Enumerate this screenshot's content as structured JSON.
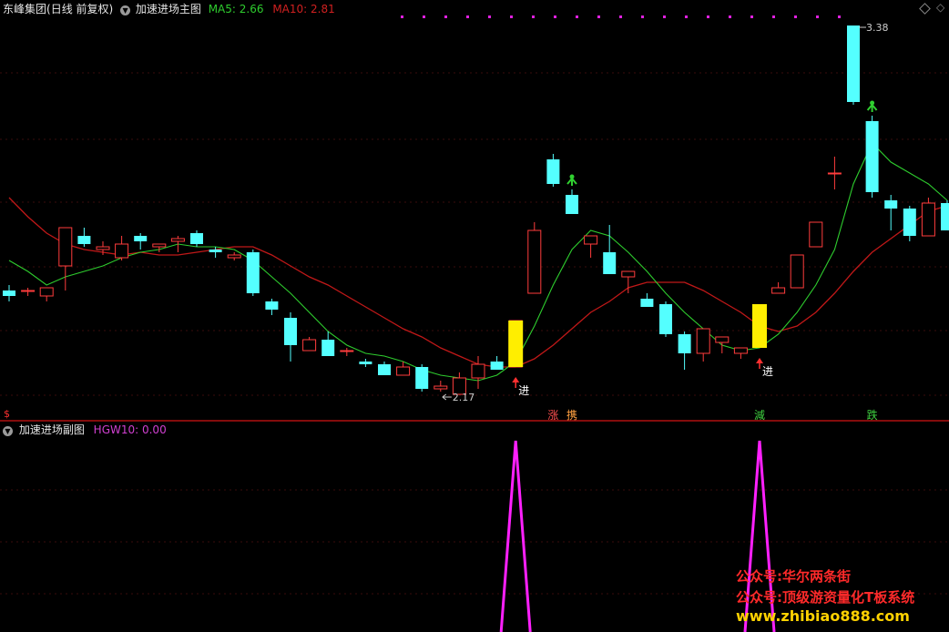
{
  "main_panel": {
    "stock_name": "东峰集团",
    "period": "(日线 前复权)",
    "indicator_name": "加速进场主图",
    "ma5_label": "MA5: 2.66",
    "ma10_label": "MA10: 2.81",
    "high_label": "3.38",
    "low_label": "2.17",
    "corner_mark": "$",
    "signal_labels": {
      "enter": "进",
      "up": "涨",
      "buy": "携",
      "reduce": "減",
      "fall": "跌"
    }
  },
  "sub_panel": {
    "indicator_name": "加速进场副图",
    "hgw_label": "HGW10: 0.00"
  },
  "watermark": {
    "line1": "公众号:华尔两条街",
    "line2": "公众号:顶级游资量化T板系统",
    "line3": "www.zhibiao888.com"
  },
  "colors": {
    "background": "#000000",
    "up_candle": "#ff3c3c",
    "down_candle": "#54ffff",
    "ma5": "#2ecc2e",
    "ma10": "#c01818",
    "signal_bar": "#ffee00",
    "hgw_line": "#ff20ff",
    "watermark_red": "#ff2a2a",
    "watermark_yellow": "#ffd200"
  },
  "chart_data": {
    "type": "candlestick",
    "title": "东峰集团(日线 前复权)",
    "ohlc": [
      [
        2.41,
        2.43,
        2.37,
        2.39
      ],
      [
        2.41,
        2.42,
        2.39,
        2.41
      ],
      [
        2.39,
        2.42,
        2.37,
        2.42
      ],
      [
        2.5,
        2.64,
        2.41,
        2.64
      ],
      [
        2.61,
        2.64,
        2.57,
        2.58
      ],
      [
        2.56,
        2.59,
        2.54,
        2.57
      ],
      [
        2.53,
        2.61,
        2.52,
        2.58
      ],
      [
        2.61,
        2.62,
        2.56,
        2.59
      ],
      [
        2.57,
        2.58,
        2.55,
        2.58
      ],
      [
        2.59,
        2.61,
        2.55,
        2.6
      ],
      [
        2.62,
        2.63,
        2.57,
        2.58
      ],
      [
        2.56,
        2.57,
        2.53,
        2.55
      ],
      [
        2.53,
        2.55,
        2.52,
        2.54
      ],
      [
        2.55,
        2.56,
        2.39,
        2.4
      ],
      [
        2.37,
        2.38,
        2.32,
        2.34
      ],
      [
        2.31,
        2.33,
        2.15,
        2.21
      ],
      [
        2.19,
        2.24,
        2.19,
        2.23
      ],
      [
        2.23,
        2.26,
        2.17,
        2.17
      ],
      [
        2.19,
        2.2,
        2.17,
        2.19
      ],
      [
        2.15,
        2.16,
        2.13,
        2.14
      ],
      [
        2.14,
        2.15,
        2.1,
        2.1
      ],
      [
        2.1,
        2.15,
        2.1,
        2.13
      ],
      [
        2.13,
        2.14,
        2.04,
        2.05
      ],
      [
        2.05,
        2.08,
        2.04,
        2.06
      ],
      [
        2.03,
        2.11,
        2.03,
        2.09
      ],
      [
        2.09,
        2.17,
        2.05,
        2.14
      ],
      [
        2.15,
        2.17,
        2.13,
        2.12
      ],
      [
        2.13,
        2.3,
        2.13,
        2.3
      ],
      [
        2.4,
        2.66,
        2.4,
        2.63
      ],
      [
        2.89,
        2.91,
        2.79,
        2.8
      ],
      [
        2.76,
        2.78,
        2.69,
        2.69
      ],
      [
        2.58,
        2.61,
        2.53,
        2.61
      ],
      [
        2.55,
        2.65,
        2.51,
        2.47
      ],
      [
        2.46,
        2.48,
        2.4,
        2.48
      ],
      [
        2.38,
        2.4,
        2.36,
        2.35
      ],
      [
        2.36,
        2.37,
        2.24,
        2.25
      ],
      [
        2.25,
        2.26,
        2.12,
        2.18
      ],
      [
        2.18,
        2.26,
        2.15,
        2.27
      ],
      [
        2.22,
        2.24,
        2.18,
        2.24
      ],
      [
        2.18,
        2.18,
        2.16,
        2.2
      ],
      [
        2.36,
        2.36,
        2.2,
        2.2
      ],
      [
        2.4,
        2.44,
        2.4,
        2.42
      ],
      [
        2.42,
        2.54,
        2.42,
        2.54
      ],
      [
        2.57,
        2.66,
        2.57,
        2.66
      ],
      [
        2.84,
        2.9,
        2.78,
        2.84
      ],
      [
        3.38,
        3.38,
        3.09,
        3.1
      ],
      [
        3.03,
        3.05,
        2.75,
        2.77
      ],
      [
        2.74,
        2.76,
        2.63,
        2.71
      ],
      [
        2.71,
        2.72,
        2.59,
        2.61
      ],
      [
        2.61,
        2.75,
        2.61,
        2.73
      ],
      [
        2.73,
        2.74,
        2.66,
        2.63
      ]
    ],
    "ma5": [
      2.52,
      2.48,
      2.43,
      2.46,
      2.48,
      2.5,
      2.53,
      2.55,
      2.56,
      2.58,
      2.57,
      2.57,
      2.56,
      2.52,
      2.46,
      2.4,
      2.33,
      2.26,
      2.21,
      2.18,
      2.17,
      2.15,
      2.12,
      2.1,
      2.09,
      2.08,
      2.1,
      2.15,
      2.28,
      2.43,
      2.56,
      2.63,
      2.61,
      2.55,
      2.48,
      2.4,
      2.33,
      2.27,
      2.21,
      2.19,
      2.2,
      2.25,
      2.33,
      2.43,
      2.56,
      2.8,
      2.95,
      2.88,
      2.84,
      2.8,
      2.74
    ],
    "ma10": [
      2.75,
      2.68,
      2.62,
      2.58,
      2.56,
      2.55,
      2.54,
      2.55,
      2.54,
      2.54,
      2.55,
      2.56,
      2.57,
      2.57,
      2.54,
      2.5,
      2.46,
      2.43,
      2.39,
      2.35,
      2.31,
      2.27,
      2.24,
      2.2,
      2.17,
      2.14,
      2.13,
      2.13,
      2.16,
      2.21,
      2.27,
      2.33,
      2.37,
      2.42,
      2.44,
      2.44,
      2.44,
      2.41,
      2.37,
      2.33,
      2.28,
      2.26,
      2.28,
      2.33,
      2.4,
      2.48,
      2.55,
      2.6,
      2.65,
      2.7,
      2.72
    ],
    "signal_bar_days": [
      27,
      40
    ],
    "up_arrows": [
      27,
      40
    ],
    "green_markers": [
      30,
      46
    ],
    "signals": [
      {
        "day": 27,
        "key": "enter"
      },
      {
        "day": 40,
        "key": "enter"
      }
    ],
    "bottom_markers": [
      {
        "day": 29,
        "key": "up",
        "color": "#ff5050"
      },
      {
        "day": 30,
        "key": "buy",
        "color": "#ffa040"
      },
      {
        "day": 40,
        "key": "reduce",
        "color": "#3fd040"
      },
      {
        "day": 46,
        "key": "fall",
        "color": "#3fd040"
      }
    ],
    "high_point": {
      "day": 45,
      "value": 3.38
    },
    "low_point": {
      "day": 23,
      "value": 2.17
    },
    "hgw10": {
      "spikes_at": [
        27,
        40
      ],
      "peak_value": 1,
      "base_value": 0
    },
    "y_range": [
      2.0,
      3.42
    ]
  }
}
